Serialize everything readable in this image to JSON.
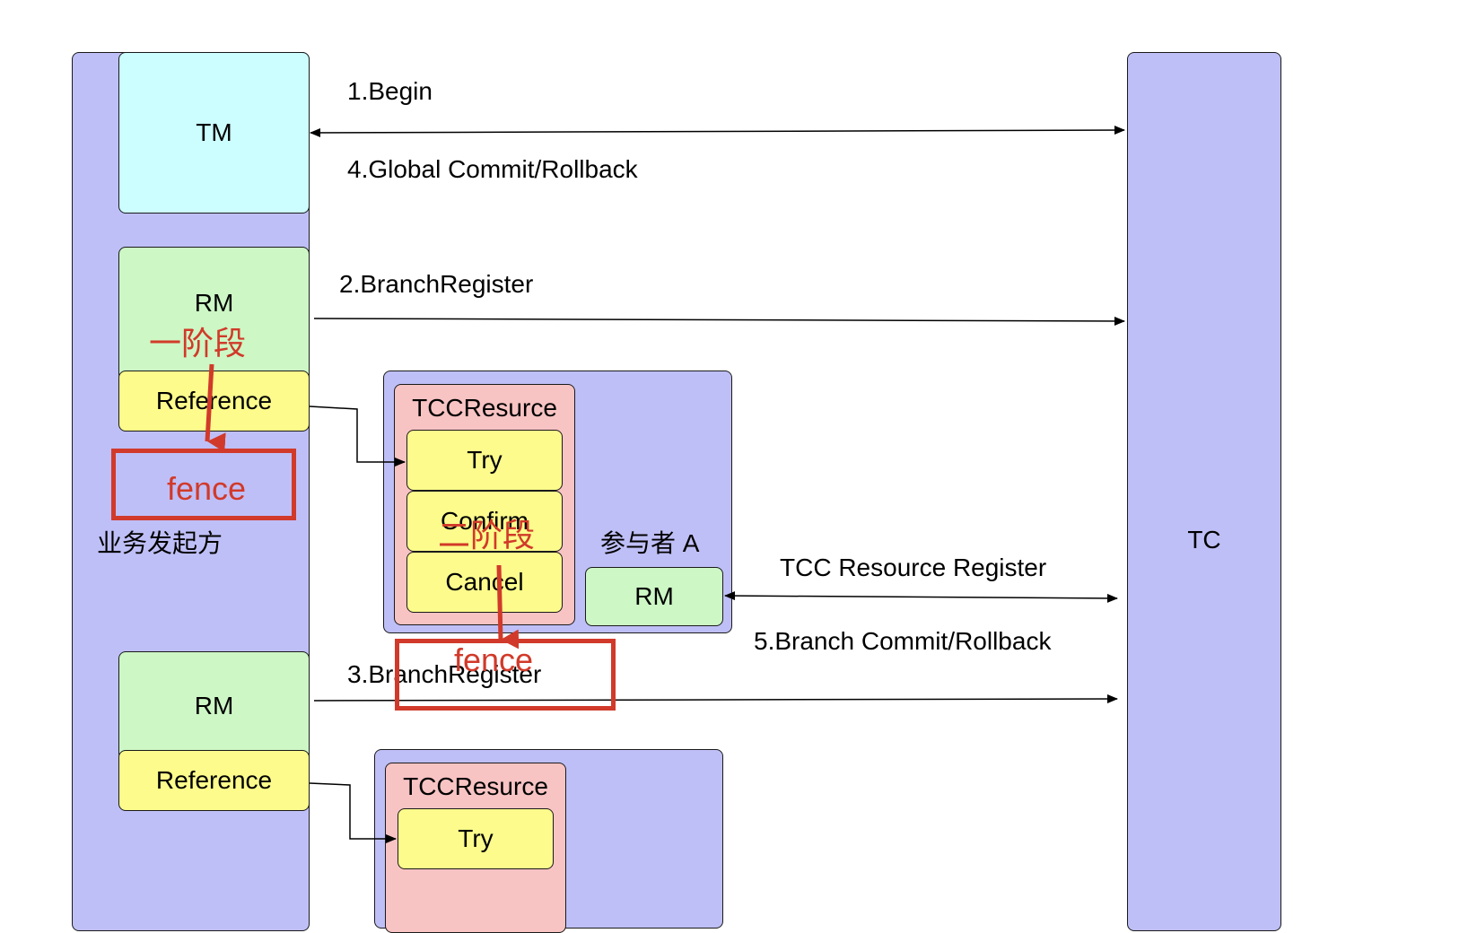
{
  "colors": {
    "lane": "#bfbff7",
    "tm": "#ccfdff",
    "rm": "#cdf7c5",
    "reference": "#fcfb8c",
    "tcc_resource": "#f8c3c3",
    "annotation": "#d13a2a"
  },
  "boxes": {
    "tm": "TM",
    "tc": "TC",
    "rm1": "RM",
    "reference1": "Reference",
    "rm2": "RM",
    "reference2": "Reference",
    "participant_rm": "RM"
  },
  "initiator_label": "业务发起方",
  "participant_label": "参与者 A",
  "tcc1": {
    "title": "TCCResurce",
    "try": "Try",
    "confirm": "Confirm",
    "cancel": "Cancel"
  },
  "tcc2": {
    "title": "TCCResurce",
    "try": "Try"
  },
  "messages": {
    "begin": "1.Begin",
    "global_commit": "4.Global Commit/Rollback",
    "branch_register_2": "2.BranchRegister",
    "branch_register_3": "3.BranchRegister",
    "tcc_resource_register": "TCC Resource Register",
    "branch_commit": "5.Branch Commit/Rollback"
  },
  "annotations": {
    "phase_one": "一阶段",
    "phase_two": "二阶段",
    "fence_1": "fence",
    "fence_2": "fence"
  }
}
